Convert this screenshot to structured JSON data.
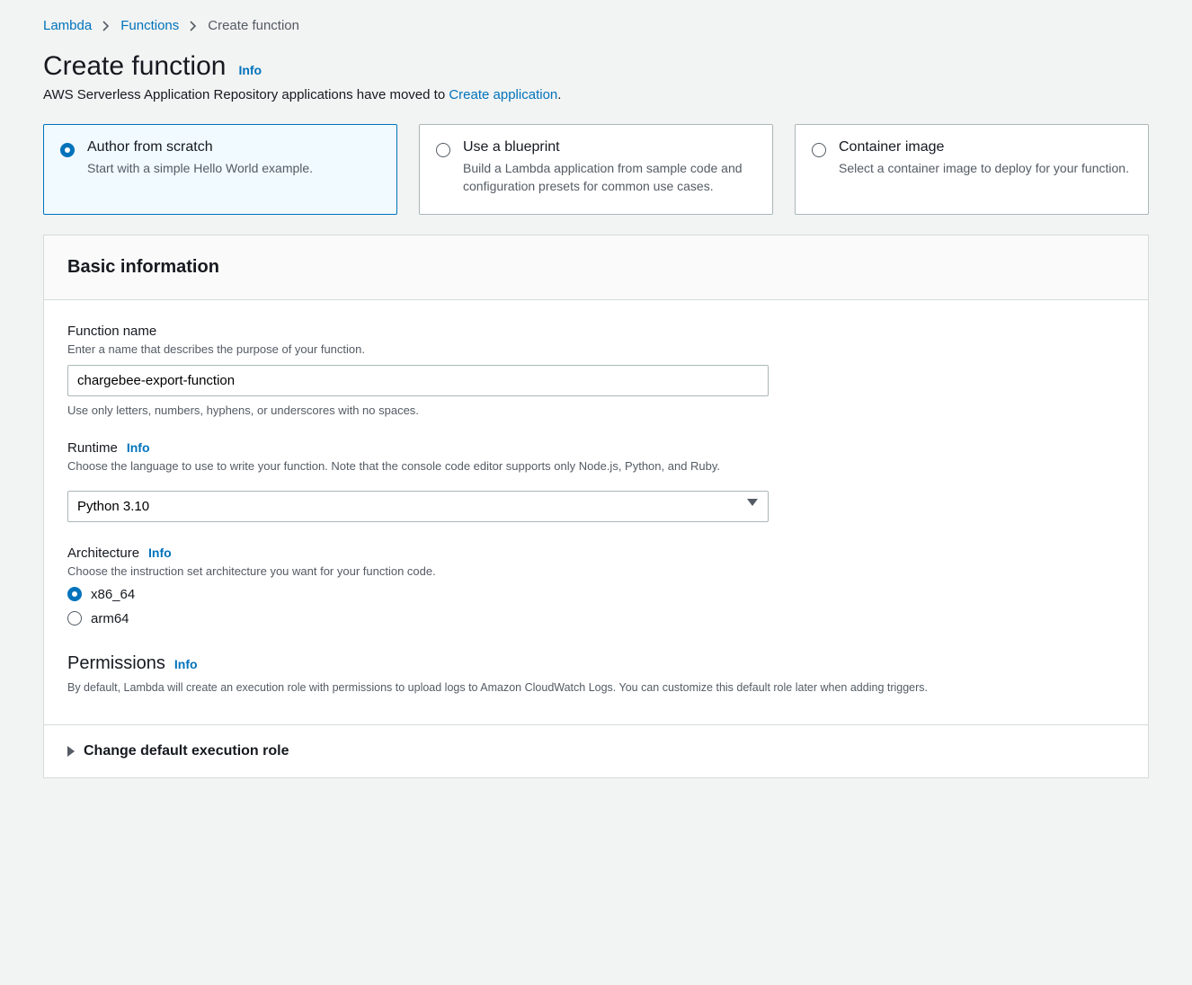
{
  "breadcrumb": {
    "items": [
      "Lambda",
      "Functions",
      "Create function"
    ]
  },
  "page": {
    "title": "Create function",
    "info": "Info",
    "subtitle_prefix": "AWS Serverless Application Repository applications have moved to ",
    "subtitle_link": "Create application",
    "subtitle_suffix": "."
  },
  "options": [
    {
      "title": "Author from scratch",
      "desc": "Start with a simple Hello World example.",
      "selected": true
    },
    {
      "title": "Use a blueprint",
      "desc": "Build a Lambda application from sample code and configuration presets for common use cases.",
      "selected": false
    },
    {
      "title": "Container image",
      "desc": "Select a container image to deploy for your function.",
      "selected": false
    }
  ],
  "panel": {
    "header": "Basic information"
  },
  "functionName": {
    "label": "Function name",
    "help": "Enter a name that describes the purpose of your function.",
    "value": "chargebee-export-function",
    "constraint": "Use only letters, numbers, hyphens, or underscores with no spaces."
  },
  "runtime": {
    "label": "Runtime",
    "info": "Info",
    "help": "Choose the language to use to write your function. Note that the console code editor supports only Node.js, Python, and Ruby.",
    "value": "Python 3.10"
  },
  "architecture": {
    "label": "Architecture",
    "info": "Info",
    "help": "Choose the instruction set architecture you want for your function code.",
    "options": [
      {
        "label": "x86_64",
        "selected": true
      },
      {
        "label": "arm64",
        "selected": false
      }
    ]
  },
  "permissions": {
    "label": "Permissions",
    "info": "Info",
    "desc": "By default, Lambda will create an execution role with permissions to upload logs to Amazon CloudWatch Logs. You can customize this default role later when adding triggers."
  },
  "expander": {
    "label": "Change default execution role"
  }
}
